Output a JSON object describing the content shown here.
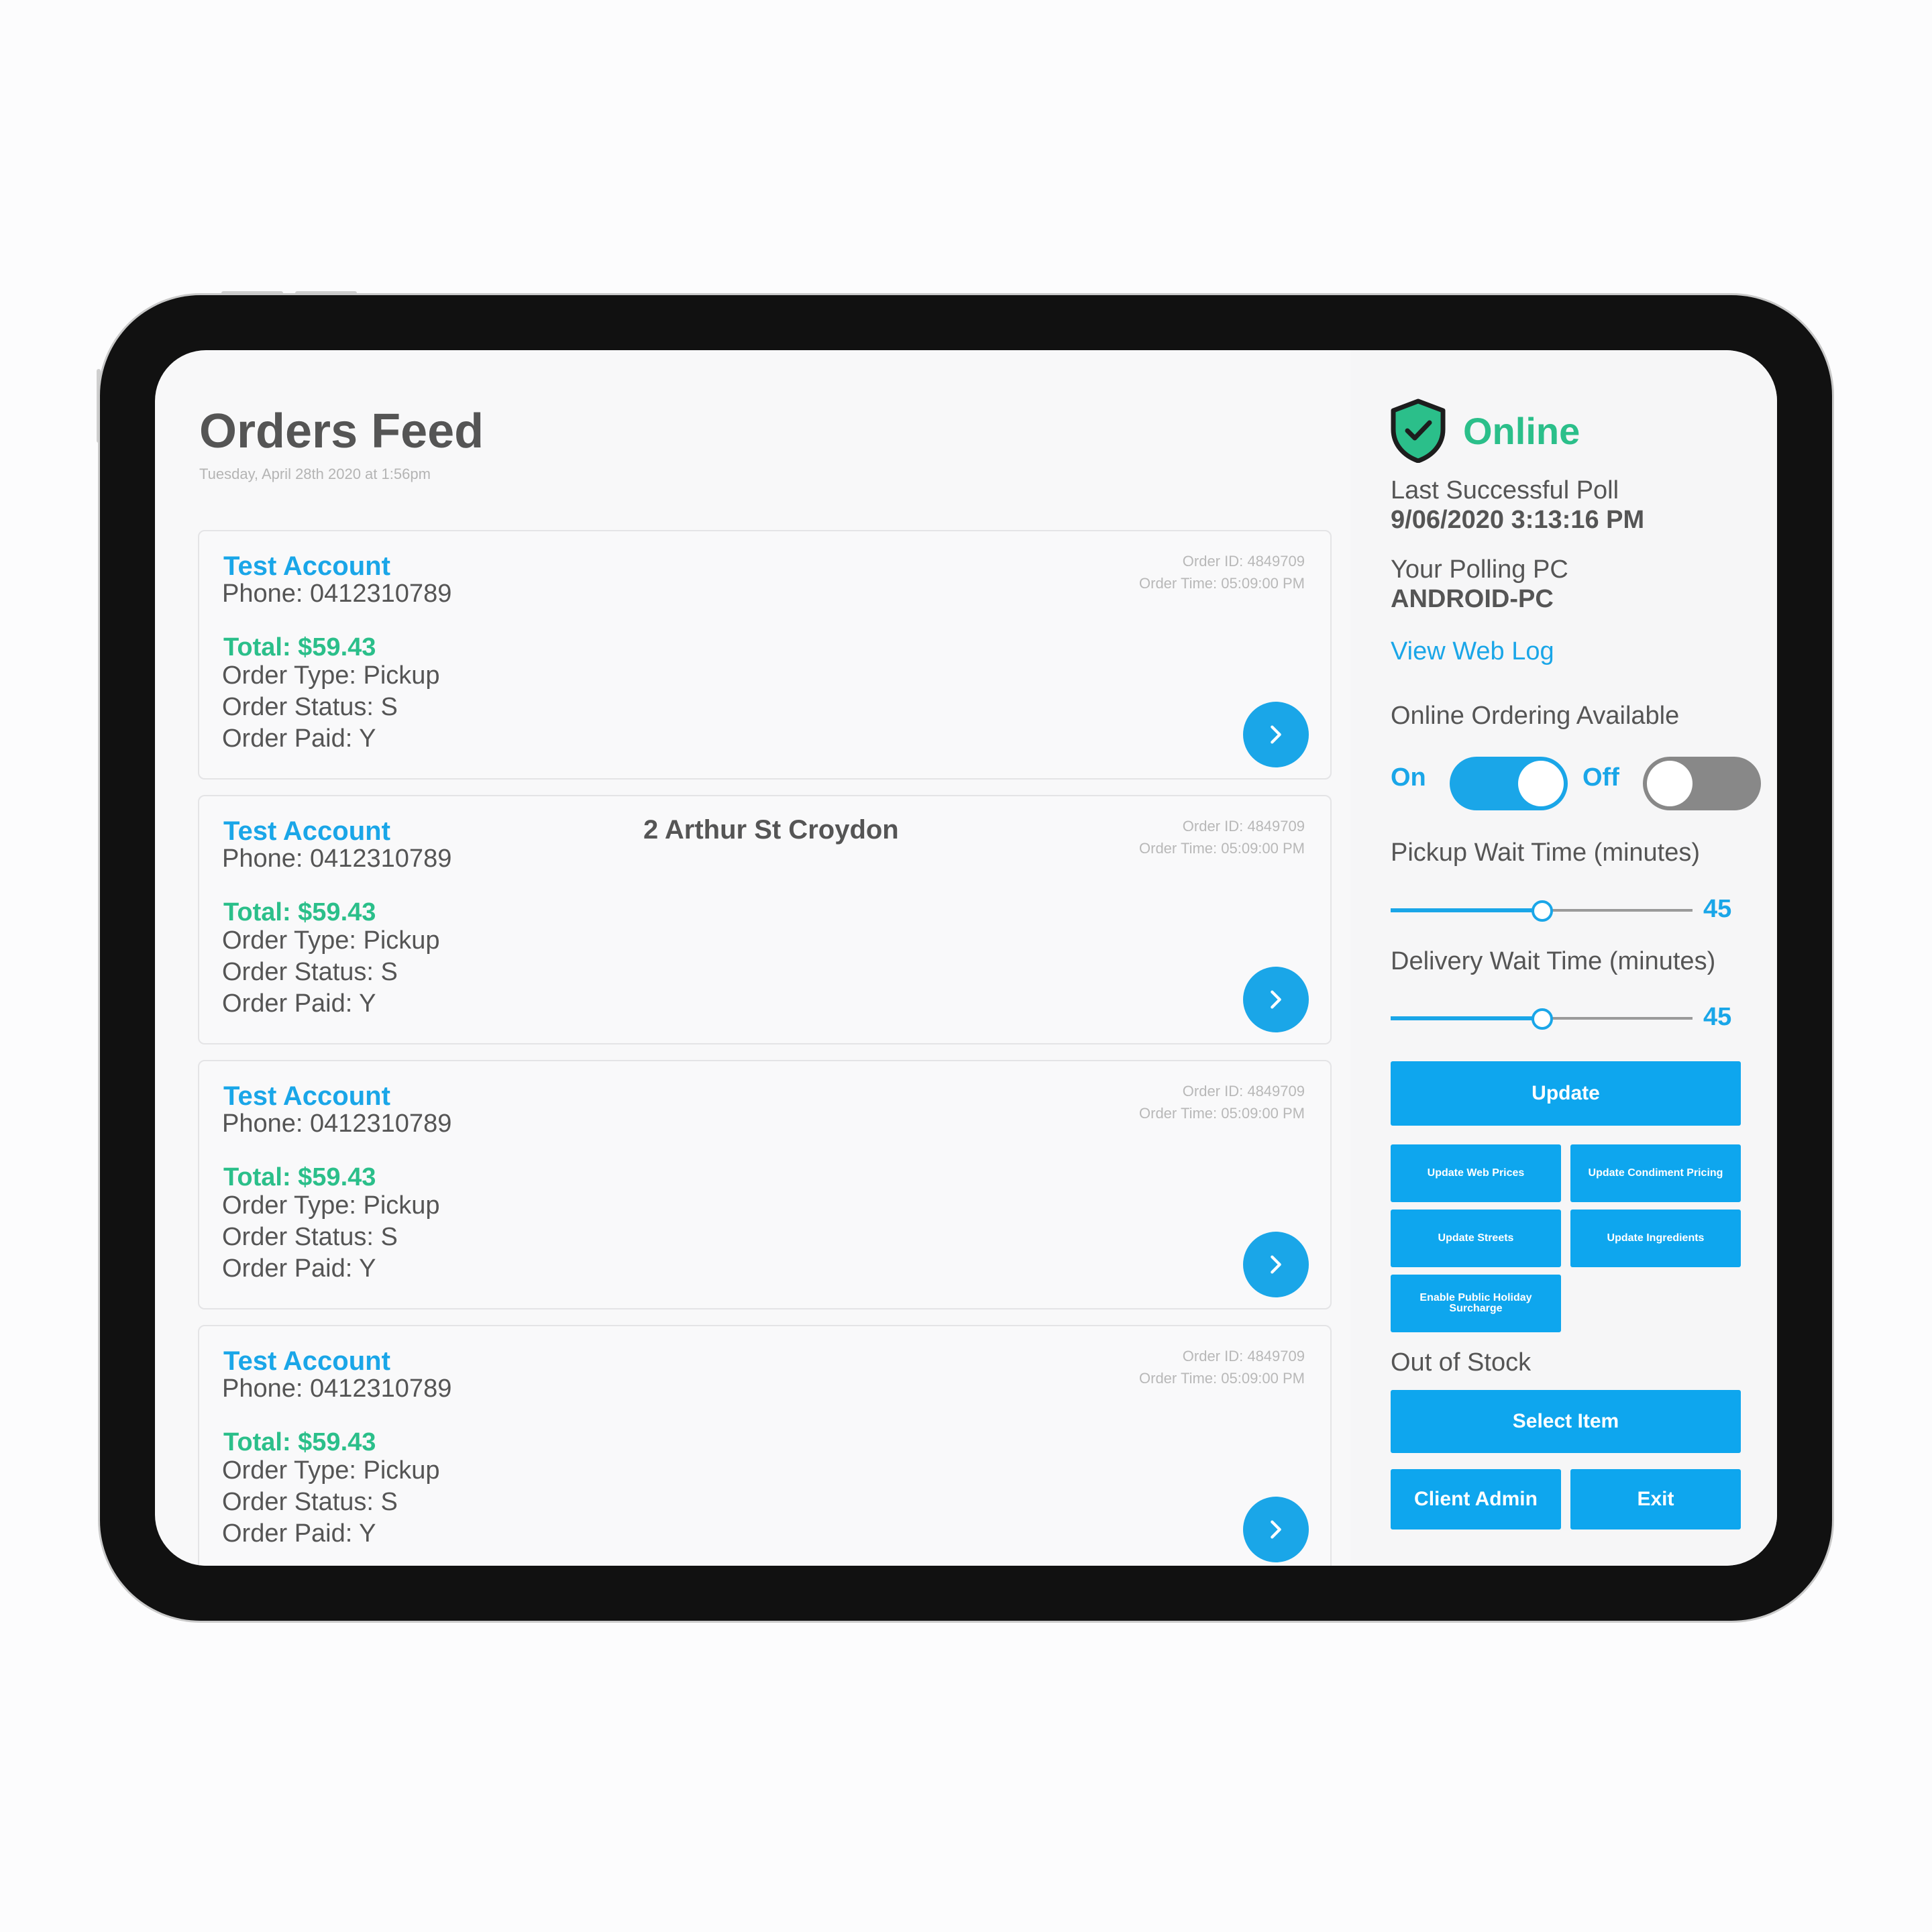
{
  "feed": {
    "title": "Orders Feed",
    "date": "Tuesday, April 28th 2020 at 1:56pm",
    "orders": [
      {
        "account": "Test Account",
        "phone": "Phone: 0412310789",
        "address": "",
        "total": "Total: $59.43",
        "type": "Order Type: Pickup",
        "status": "Order Status: S",
        "paid": "Order Paid: Y",
        "order_id": "Order ID: 4849709",
        "order_time": "Order Time: 05:09:00 PM"
      },
      {
        "account": "Test Account",
        "phone": "Phone: 0412310789",
        "address": "2 Arthur St Croydon",
        "total": "Total: $59.43",
        "type": "Order Type: Pickup",
        "status": "Order Status: S",
        "paid": "Order Paid: Y",
        "order_id": "Order ID: 4849709",
        "order_time": "Order Time: 05:09:00 PM"
      },
      {
        "account": "Test Account",
        "phone": "Phone: 0412310789",
        "address": "",
        "total": "Total: $59.43",
        "type": "Order Type: Pickup",
        "status": "Order Status: S",
        "paid": "Order Paid: Y",
        "order_id": "Order ID: 4849709",
        "order_time": "Order Time: 05:09:00 PM"
      },
      {
        "account": "Test Account",
        "phone": "Phone: 0412310789",
        "address": "",
        "total": "Total: $59.43",
        "type": "Order Type: Pickup",
        "status": "Order Status: S",
        "paid": "Order Paid: Y",
        "order_id": "Order ID: 4849709",
        "order_time": "Order Time: 05:09:00 PM"
      }
    ]
  },
  "sidebar": {
    "status": "Online",
    "last_poll_label": "Last Successful Poll",
    "last_poll_value": "9/06/2020 3:13:16 PM",
    "polling_pc_label": "Your Polling PC",
    "polling_pc_value": "ANDROID-PC",
    "web_log_link": "View Web Log",
    "online_ordering_label": "Online Ordering Available",
    "toggle_on_label": "On",
    "toggle_off_label": "Off",
    "toggle_on_state": true,
    "toggle_off_state": false,
    "pickup_label": "Pickup Wait Time (minutes)",
    "pickup_value": "45",
    "pickup_fraction": 0.5,
    "delivery_label": "Delivery Wait Time (minutes)",
    "delivery_value": "45",
    "delivery_fraction": 0.5,
    "update_button": "Update",
    "update_web_prices": "Update Web Prices",
    "update_condiment_pricing": "Update Condiment Pricing",
    "update_streets": "Update Streets",
    "update_ingredients": "Update Ingredients",
    "enable_holiday_surcharge": "Enable Public Holiday Surcharge",
    "out_of_stock_label": "Out of Stock",
    "select_item_button": "Select Item",
    "client_admin_button": "Client Admin",
    "exit_button": "Exit"
  },
  "colors": {
    "accent": "#1aa6e8",
    "success": "#2bbf8a",
    "text": "#555555",
    "muted": "#b8b8b8"
  },
  "icons": {
    "status": "shield-check-icon",
    "order_action": "chevron-right-icon"
  }
}
